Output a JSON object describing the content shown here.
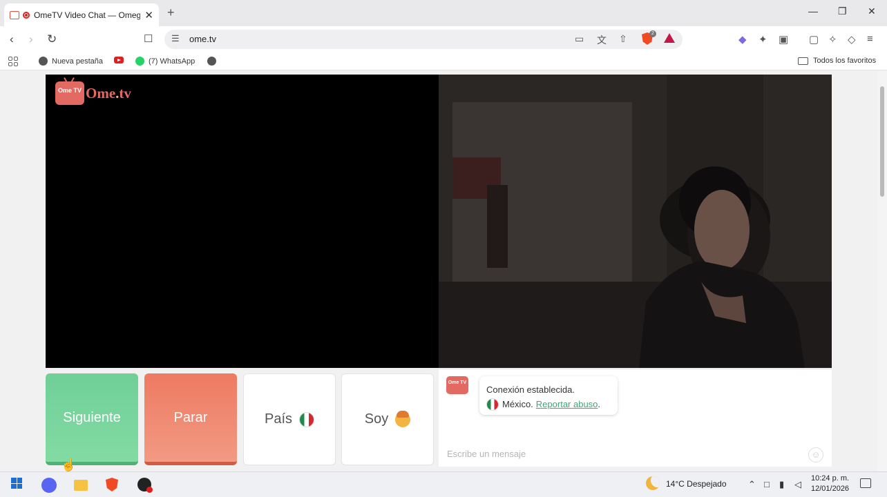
{
  "browser": {
    "tab_title": "OmeTV Video Chat — Omeg",
    "tab_close": "✕",
    "new_tab": "+",
    "url": "ome.tv",
    "window": {
      "minimize": "—",
      "maximize": "❐",
      "close": "✕"
    },
    "shields_count": "2"
  },
  "bookmarks": {
    "items": [
      {
        "label": "Nueva pestaña",
        "icon": "globe-icon"
      },
      {
        "label": "",
        "icon": "youtube-icon"
      },
      {
        "label": "(7) WhatsApp",
        "icon": "whatsapp-icon"
      },
      {
        "label": "",
        "icon": "globe-icon"
      }
    ],
    "folder_label": "Todos los favoritos"
  },
  "app": {
    "logo_tv": "Ome TV",
    "logo_text_main": "Ome",
    "logo_text_dot": ".",
    "logo_text_end": "tv",
    "buttons": {
      "next": "Siguiente",
      "stop": "Parar",
      "country": "País",
      "gender": "Soy"
    },
    "country_flag": "mexico",
    "chat": {
      "logo": "Ome TV",
      "message_line1": "Conexión establecida.",
      "country": "México.",
      "report_link": "Reportar abuso",
      "report_suffix": ".",
      "input_placeholder": "Escribe un mensaje",
      "emoji_glyph": "☺"
    }
  },
  "taskbar": {
    "weather": "14°C  Despejado",
    "time": "10:24 p. m.",
    "date": "12/01/2026"
  },
  "colors": {
    "next_button": "#6fcf97",
    "stop_button": "#ee7a62",
    "brand": "#e36a62",
    "link": "#3aa87a"
  }
}
